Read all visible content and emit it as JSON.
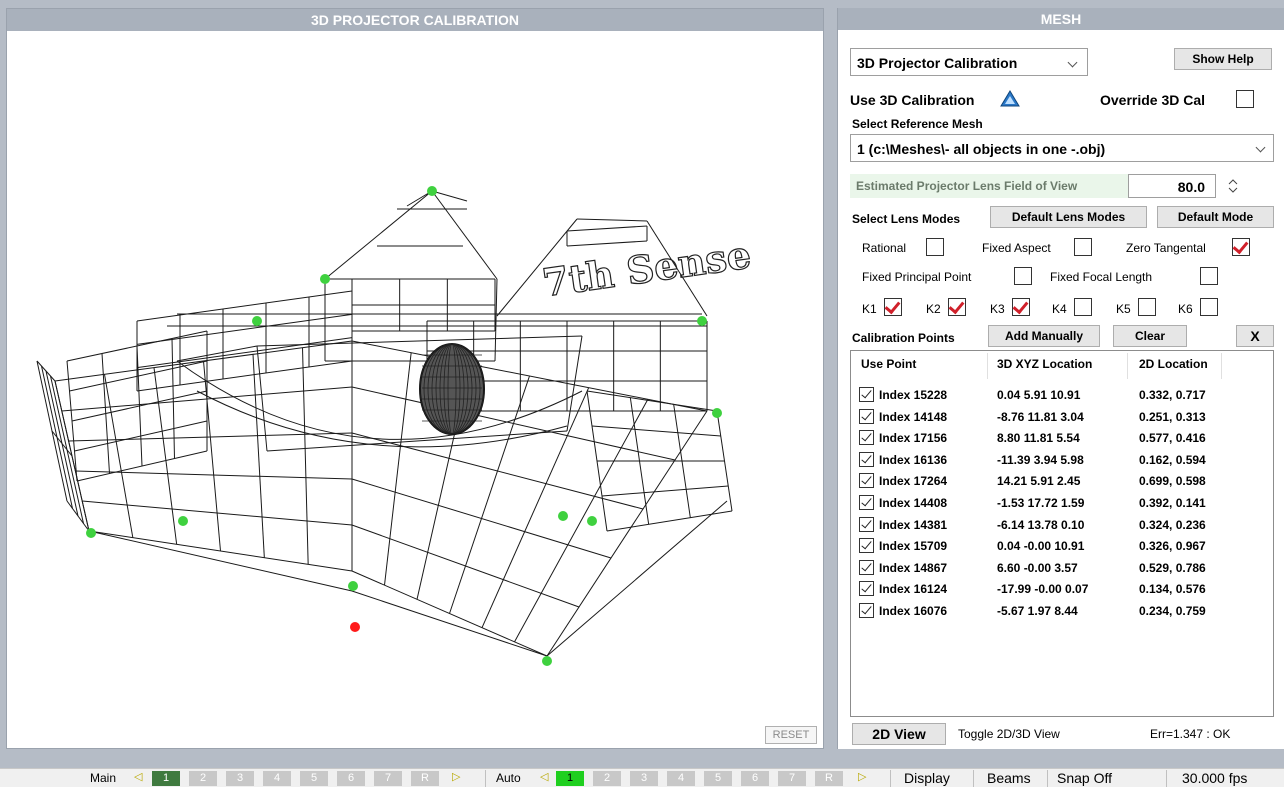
{
  "viewport": {
    "title": "3D PROJECTOR CALIBRATION",
    "reset_label": "RESET",
    "logo_text": "7th Sense"
  },
  "mesh": {
    "title": "MESH",
    "mode_dropdown": "3D Projector Calibration",
    "show_help": "Show Help",
    "use_3d_calibration": "Use 3D Calibration",
    "override_3d_cal": "Override 3D Cal",
    "select_reference_mesh": "Select Reference Mesh",
    "mesh_dropdown": "1 (c:\\Meshes\\- all objects in one -.obj)",
    "fov_label": "Estimated Projector Lens Field of View",
    "fov_value": "80.0",
    "select_lens_modes": "Select Lens Modes",
    "default_lens_modes": "Default Lens Modes",
    "default_mode": "Default Mode",
    "rational": "Rational",
    "fixed_aspect": "Fixed Aspect",
    "zero_tangental": "Zero Tangental",
    "fixed_principal_point": "Fixed Principal Point",
    "fixed_focal_length": "Fixed Focal Length",
    "k": [
      "K1",
      "K2",
      "K3",
      "K4",
      "K5",
      "K6"
    ],
    "k_checked": [
      true,
      true,
      true,
      false,
      false,
      false
    ],
    "calibration_points": "Calibration Points",
    "add_manually": "Add Manually",
    "clear": "Clear",
    "close": "X",
    "columns": [
      "Use Point",
      "3D XYZ Location",
      "2D Location"
    ],
    "rows": [
      {
        "index": "Index 15228",
        "xyz": "0.04 5.91 10.91",
        "loc2d": "0.332, 0.717"
      },
      {
        "index": "Index 14148",
        "xyz": "-8.76 11.81 3.04",
        "loc2d": "0.251, 0.313"
      },
      {
        "index": "Index 17156",
        "xyz": "8.80 11.81 5.54",
        "loc2d": "0.577, 0.416"
      },
      {
        "index": "Index 16136",
        "xyz": "-11.39 3.94 5.98",
        "loc2d": "0.162, 0.594"
      },
      {
        "index": "Index 17264",
        "xyz": "14.21 5.91 2.45",
        "loc2d": "0.699, 0.598"
      },
      {
        "index": "Index 14408",
        "xyz": "-1.53 17.72 1.59",
        "loc2d": "0.392, 0.141"
      },
      {
        "index": "Index 14381",
        "xyz": "-6.14 13.78 0.10",
        "loc2d": "0.324, 0.236"
      },
      {
        "index": "Index 15709",
        "xyz": "0.04 -0.00 10.91",
        "loc2d": "0.326, 0.967"
      },
      {
        "index": "Index 14867",
        "xyz": "6.60 -0.00 3.57",
        "loc2d": "0.529, 0.786"
      },
      {
        "index": "Index 16124",
        "xyz": "-17.99 -0.00 0.07",
        "loc2d": "0.134, 0.576"
      },
      {
        "index": "Index 16076",
        "xyz": "-5.67 1.97 8.44",
        "loc2d": "0.234, 0.759"
      }
    ],
    "view_button": "2D View",
    "toggle_label": "Toggle 2D/3D View",
    "err_status": "Err=1.347 : OK"
  },
  "bottombar": {
    "main_label": "Main",
    "auto_label": "Auto",
    "segments": [
      "1",
      "2",
      "3",
      "4",
      "5",
      "6",
      "7",
      "R"
    ],
    "display": "Display",
    "beams": "Beams",
    "snap": "Snap Off",
    "fps": "30.000 fps"
  },
  "colors": {
    "header_bg": "#a9b1bc",
    "check_red": "#d0202a",
    "point_green": "#3fd13f",
    "point_red": "#ff1a1a"
  }
}
